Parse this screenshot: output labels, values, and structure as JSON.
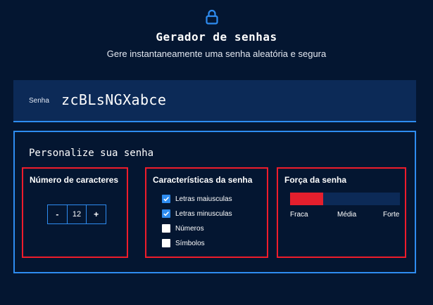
{
  "header": {
    "icon": "lock-icon",
    "title": "Gerador de senhas",
    "subtitle": "Gere instantaneamente uma senha aleatória e segura"
  },
  "password": {
    "label": "Senha",
    "value": "zcBLsNGXabce"
  },
  "customize": {
    "title": "Personalize sua senha",
    "length": {
      "title": "Número de caracteres",
      "decrement_label": "-",
      "value": "12",
      "increment_label": "+"
    },
    "characteristics": {
      "title": "Características da senha",
      "options": [
        {
          "label": "Letras maiusculas",
          "checked": true
        },
        {
          "label": "Letras minusculas",
          "checked": true
        },
        {
          "label": "Números",
          "checked": false
        },
        {
          "label": "Símbolos",
          "checked": false
        }
      ]
    },
    "strength": {
      "title": "Força da senha",
      "level_fraction": 0.3,
      "levels": [
        "Fraca",
        "Média",
        "Forte"
      ]
    }
  },
  "colors": {
    "background": "#041631",
    "panel": "#0c2a57",
    "accent": "#2e8cf0",
    "highlight_border": "#ef1c2b",
    "strength_fill": "#e41f2d"
  }
}
